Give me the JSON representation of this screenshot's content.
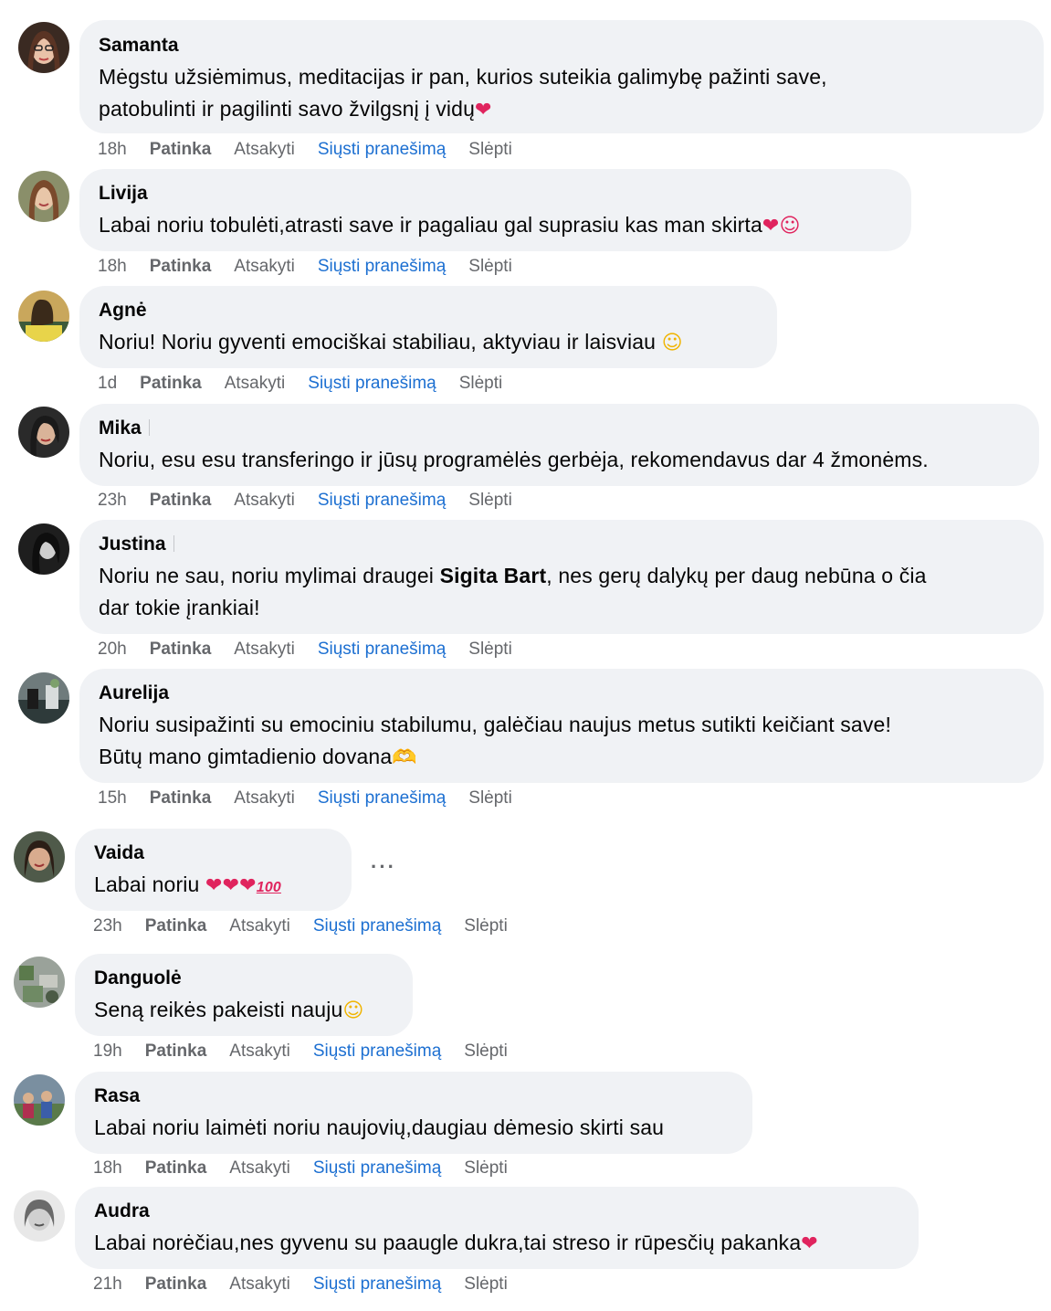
{
  "actions": {
    "like": "Patinka",
    "reply": "Atsakyti",
    "send_message": "Siųsti pranešimą",
    "hide": "Slėpti"
  },
  "comments": [
    {
      "author": "Samanta",
      "time": "18h",
      "line1": "Mėgstu užsiėmimus, meditacijas ir pan, kurios suteikia galimybę pažinti save,",
      "line2": "patobulinti ir pagilinti savo žvilgsnį į vidų",
      "emoji": "❤"
    },
    {
      "author": "Livija",
      "time": "18h",
      "line1": "Labai noriu tobulėti,atrasti save ir pagaliau gal suprasiu kas man skirta",
      "emoji": "❤☺"
    },
    {
      "author": "Agnė",
      "time": "1d",
      "line1": "Noriu! Noriu gyventi emociškai stabiliau, aktyviau ir laisviau ",
      "emoji": "☺"
    },
    {
      "author": "Mika",
      "time": "23h",
      "line1": "Noriu, esu esu transferingo ir jūsų programėlės gerbėja, rekomendavus dar 4 žmonėms."
    },
    {
      "author": "Justina",
      "time": "20h",
      "line1_pre": "Noriu ne sau, noriu mylimai draugei ",
      "mention": "Sigita Bart",
      "line1_post": ", nes gerų dalykų per daug nebūna o čia",
      "line2": "dar tokie įrankiai!"
    },
    {
      "author": "Aurelija",
      "time": "15h",
      "line1": "Noriu susipažinti su emociniu stabilumu, galėčiau naujus metus sutikti keičiant save!",
      "line2": "Būtų mano gimtadienio dovana",
      "emoji": "🫶"
    },
    {
      "author": "Vaida",
      "time": "23h",
      "line1": "Labai noriu ",
      "emoji": "❤❤❤",
      "emoji2": "100",
      "more": "···"
    },
    {
      "author": "Danguolė",
      "time": "19h",
      "line1": "Seną reikės pakeisti nauju",
      "emoji": "☺"
    },
    {
      "author": "Rasa",
      "time": "18h",
      "line1": "Labai noriu laimėti noriu naujovių,daugiau dėmesio skirti sau"
    },
    {
      "author": "Audra",
      "time": "21h",
      "line1": "Labai norėčiau,nes gyvenu su paaugle dukra,tai streso ir rūpesčių pakanka",
      "emoji": "❤"
    }
  ]
}
